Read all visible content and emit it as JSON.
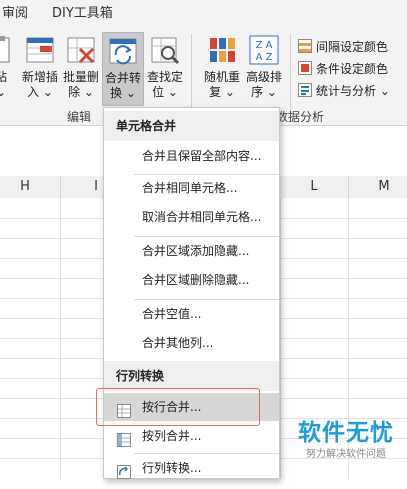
{
  "menubar": {
    "tabs": [
      "审阅",
      "DIY工具箱"
    ]
  },
  "ribbon": {
    "buttons": [
      {
        "label1": "粘",
        "label2": "⌄"
      },
      {
        "label1": "新增插",
        "label2": "入 ⌄"
      },
      {
        "label1": "批量删",
        "label2": "除 ⌄"
      },
      {
        "label1": "合并转",
        "label2": "换 ⌄"
      },
      {
        "label1": "查找定",
        "label2": "位 ⌄"
      },
      {
        "label1": "随机重",
        "label2": "复 ⌄"
      },
      {
        "label1": "高级排",
        "label2": "序 ⌄"
      }
    ],
    "sort_icon_top": "Z A",
    "sort_icon_bottom": "A Z",
    "group_edit": "编辑",
    "group_data": "数据分析",
    "small_cmds": [
      "间隔设定颜色",
      "条件设定颜色",
      "统计与分析 ⌄"
    ]
  },
  "columns": [
    "H",
    "I",
    "L",
    "M"
  ],
  "dropdown": {
    "header1": "单元格合并",
    "items1": [
      "合并且保留全部内容...",
      "合并相同单元格...",
      "取消合并相同单元格...",
      "合并区域添加隐藏...",
      "合并区域删除隐藏...",
      "合并空值...",
      "合并其他列..."
    ],
    "header2": "行列转换",
    "items2": [
      "按行合并...",
      "按列合并...",
      "行列转换..."
    ]
  },
  "watermark": {
    "title": "软件无忧",
    "subtitle": "努力解决软件问题"
  },
  "colors": {
    "accent_blue": "#1f9ce0",
    "highlight_red": "#e06a6a",
    "menu_highlight": "#d6d6d6"
  }
}
